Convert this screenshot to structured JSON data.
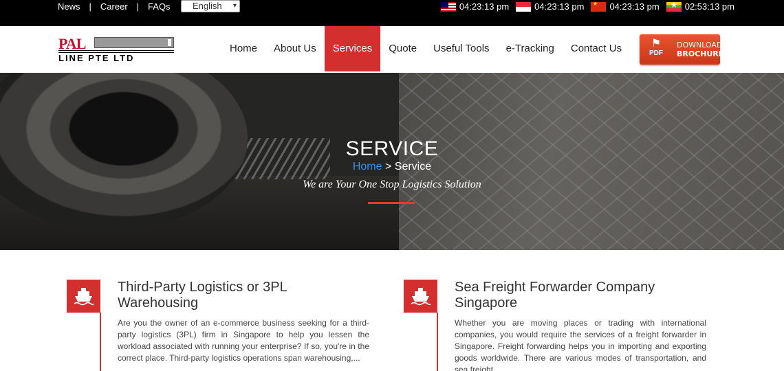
{
  "topbar": {
    "links": [
      "News",
      "Career",
      "FAQs"
    ],
    "separator": "|",
    "language": "English",
    "clocks": [
      {
        "flag": "malaysia-flag-icon",
        "time": "04:23:13 pm"
      },
      {
        "flag": "singapore-flag-icon",
        "time": "04:23:13 pm"
      },
      {
        "flag": "china-flag-icon",
        "time": "04:23:13 pm"
      },
      {
        "flag": "myanmar-flag-icon",
        "time": "02:53:13 pm"
      }
    ]
  },
  "logo": {
    "top": "PAL",
    "bottom": "LINE PTE LTD"
  },
  "nav": {
    "items": [
      "Home",
      "About Us",
      "Services",
      "Quote",
      "Useful Tools",
      "e-Tracking",
      "Contact Us"
    ],
    "active": "Services"
  },
  "brochure": {
    "icon_label": "PDF",
    "line1": "DOWNLOAD",
    "line2": "BROCHURE"
  },
  "hero": {
    "title": "SERVICE",
    "crumb_home": "Home",
    "crumb_sep": ">",
    "crumb_current": "Service",
    "tagline": "We are Your One Stop Logistics Solution"
  },
  "services": [
    {
      "title": "Third-Party Logistics or 3PL Warehousing",
      "desc": "Are you the owner of an e-commerce business seeking for a third-party logistics (3PL) firm in Singapore to help you lessen the workload associated with running your enterprise? If so, you're in the correct place. Third-party logistics operations span warehousing,...",
      "icon": "ship-icon"
    },
    {
      "title": "Sea Freight Forwarder Company Singapore",
      "desc": "Whether you are moving places or trading with international companies, you would require the services of a freight forwarder in Singapore. Freight forwarding helps you in importing and exporting goods worldwide. There are various modes of transportation, and sea freight...",
      "icon": "ship-icon"
    }
  ],
  "colors": {
    "accent": "#d32f2f",
    "topbar": "#000000",
    "link_blue": "#3f8fe0"
  }
}
